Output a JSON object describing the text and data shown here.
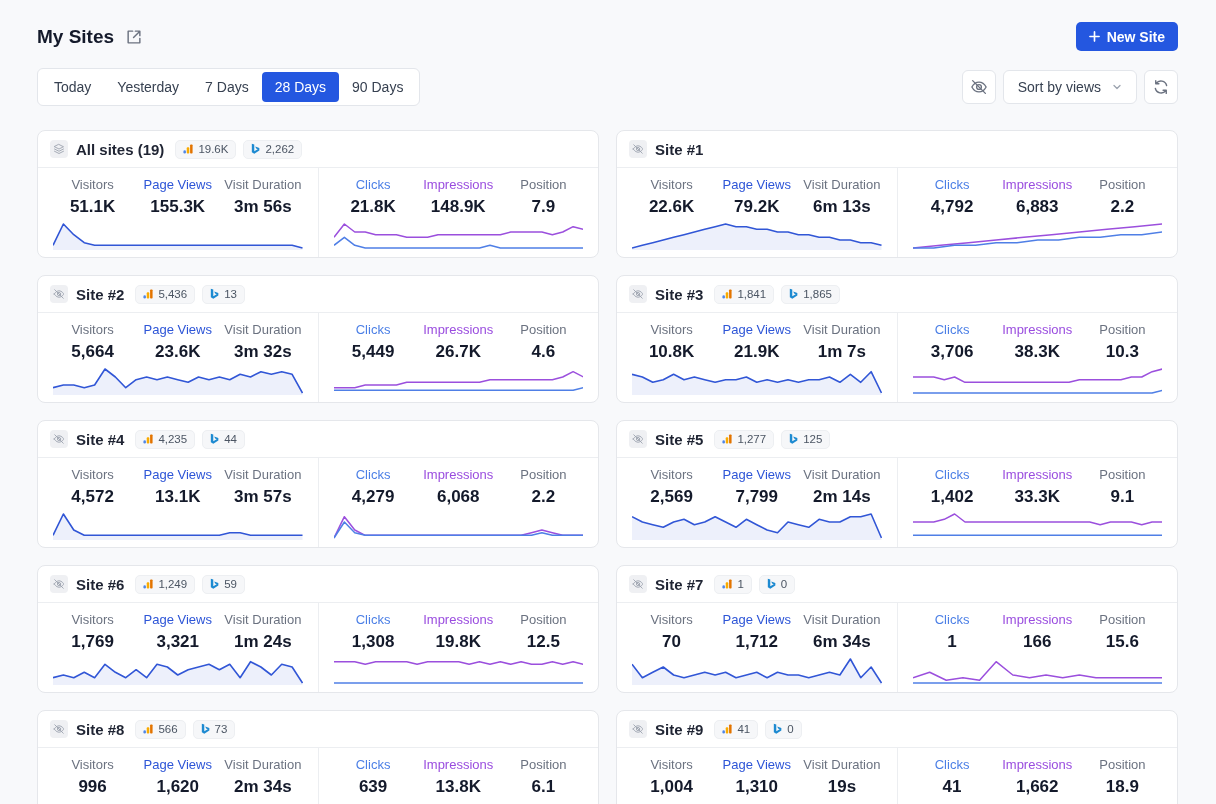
{
  "page": {
    "title": "My Sites"
  },
  "new_site_button": {
    "label": "New Site"
  },
  "ranges": [
    {
      "label": "Today",
      "selected": false
    },
    {
      "label": "Yesterday",
      "selected": false
    },
    {
      "label": "7 Days",
      "selected": false
    },
    {
      "label": "28 Days",
      "selected": true
    },
    {
      "label": "90 Days",
      "selected": false
    }
  ],
  "sort": {
    "label": "Sort by views"
  },
  "cards": [
    {
      "kind": "all",
      "name": "All sites (19)",
      "badges": [
        {
          "kind": "analytics",
          "count": "19.6K"
        },
        {
          "kind": "search",
          "count": "2,262"
        }
      ],
      "analytics": [
        {
          "kind": "visitors",
          "label": "Visitors",
          "value": "51.1K"
        },
        {
          "kind": "pageviews",
          "label": "Page Views",
          "value": "155.3K"
        },
        {
          "kind": "duration",
          "label": "Visit Duration",
          "value": "3m 56s"
        }
      ],
      "search": [
        {
          "kind": "clicks",
          "label": "Clicks",
          "value": "21.8K"
        },
        {
          "kind": "impressions",
          "label": "Impressions",
          "value": "148.9K"
        },
        {
          "kind": "position",
          "label": "Position",
          "value": "7.9"
        }
      ]
    },
    {
      "kind": "site",
      "name": "Site #1",
      "analytics": [
        {
          "kind": "visitors",
          "label": "Visitors",
          "value": "22.6K"
        },
        {
          "kind": "pageviews",
          "label": "Page Views",
          "value": "79.2K"
        },
        {
          "kind": "duration",
          "label": "Visit Duration",
          "value": "6m 13s"
        }
      ],
      "search": [
        {
          "kind": "clicks",
          "label": "Clicks",
          "value": "4,792"
        },
        {
          "kind": "impressions",
          "label": "Impressions",
          "value": "6,883"
        },
        {
          "kind": "position",
          "label": "Position",
          "value": "2.2"
        }
      ]
    },
    {
      "kind": "site",
      "name": "Site #2",
      "badges": [
        {
          "kind": "analytics",
          "count": "5,436"
        },
        {
          "kind": "search",
          "count": "13"
        }
      ],
      "analytics": [
        {
          "kind": "visitors",
          "label": "Visitors",
          "value": "5,664"
        },
        {
          "kind": "pageviews",
          "label": "Page Views",
          "value": "23.6K"
        },
        {
          "kind": "duration",
          "label": "Visit Duration",
          "value": "3m 32s"
        }
      ],
      "search": [
        {
          "kind": "clicks",
          "label": "Clicks",
          "value": "5,449"
        },
        {
          "kind": "impressions",
          "label": "Impressions",
          "value": "26.7K"
        },
        {
          "kind": "position",
          "label": "Position",
          "value": "4.6"
        }
      ]
    },
    {
      "kind": "site",
      "name": "Site #3",
      "badges": [
        {
          "kind": "analytics",
          "count": "1,841"
        },
        {
          "kind": "search",
          "count": "1,865"
        }
      ],
      "analytics": [
        {
          "kind": "visitors",
          "label": "Visitors",
          "value": "10.8K"
        },
        {
          "kind": "pageviews",
          "label": "Page Views",
          "value": "21.9K"
        },
        {
          "kind": "duration",
          "label": "Visit Duration",
          "value": "1m 7s"
        }
      ],
      "search": [
        {
          "kind": "clicks",
          "label": "Clicks",
          "value": "3,706"
        },
        {
          "kind": "impressions",
          "label": "Impressions",
          "value": "38.3K"
        },
        {
          "kind": "position",
          "label": "Position",
          "value": "10.3"
        }
      ]
    },
    {
      "kind": "site",
      "name": "Site #4",
      "badges": [
        {
          "kind": "analytics",
          "count": "4,235"
        },
        {
          "kind": "search",
          "count": "44"
        }
      ],
      "analytics": [
        {
          "kind": "visitors",
          "label": "Visitors",
          "value": "4,572"
        },
        {
          "kind": "pageviews",
          "label": "Page Views",
          "value": "13.1K"
        },
        {
          "kind": "duration",
          "label": "Visit Duration",
          "value": "3m 57s"
        }
      ],
      "search": [
        {
          "kind": "clicks",
          "label": "Clicks",
          "value": "4,279"
        },
        {
          "kind": "impressions",
          "label": "Impressions",
          "value": "6,068"
        },
        {
          "kind": "position",
          "label": "Position",
          "value": "2.2"
        }
      ]
    },
    {
      "kind": "site",
      "name": "Site #5",
      "badges": [
        {
          "kind": "analytics",
          "count": "1,277"
        },
        {
          "kind": "search",
          "count": "125"
        }
      ],
      "analytics": [
        {
          "kind": "visitors",
          "label": "Visitors",
          "value": "2,569"
        },
        {
          "kind": "pageviews",
          "label": "Page Views",
          "value": "7,799"
        },
        {
          "kind": "duration",
          "label": "Visit Duration",
          "value": "2m 14s"
        }
      ],
      "search": [
        {
          "kind": "clicks",
          "label": "Clicks",
          "value": "1,402"
        },
        {
          "kind": "impressions",
          "label": "Impressions",
          "value": "33.3K"
        },
        {
          "kind": "position",
          "label": "Position",
          "value": "9.1"
        }
      ]
    },
    {
      "kind": "site",
      "name": "Site #6",
      "badges": [
        {
          "kind": "analytics",
          "count": "1,249"
        },
        {
          "kind": "search",
          "count": "59"
        }
      ],
      "analytics": [
        {
          "kind": "visitors",
          "label": "Visitors",
          "value": "1,769"
        },
        {
          "kind": "pageviews",
          "label": "Page Views",
          "value": "3,321"
        },
        {
          "kind": "duration",
          "label": "Visit Duration",
          "value": "1m 24s"
        }
      ],
      "search": [
        {
          "kind": "clicks",
          "label": "Clicks",
          "value": "1,308"
        },
        {
          "kind": "impressions",
          "label": "Impressions",
          "value": "19.8K"
        },
        {
          "kind": "position",
          "label": "Position",
          "value": "12.5"
        }
      ]
    },
    {
      "kind": "site",
      "name": "Site #7",
      "badges": [
        {
          "kind": "analytics",
          "count": "1"
        },
        {
          "kind": "search",
          "count": "0"
        }
      ],
      "analytics": [
        {
          "kind": "visitors",
          "label": "Visitors",
          "value": "70"
        },
        {
          "kind": "pageviews",
          "label": "Page Views",
          "value": "1,712"
        },
        {
          "kind": "duration",
          "label": "Visit Duration",
          "value": "6m 34s"
        }
      ],
      "search": [
        {
          "kind": "clicks",
          "label": "Clicks",
          "value": "1"
        },
        {
          "kind": "impressions",
          "label": "Impressions",
          "value": "166"
        },
        {
          "kind": "position",
          "label": "Position",
          "value": "15.6"
        }
      ]
    },
    {
      "kind": "site",
      "name": "Site #8",
      "badges": [
        {
          "kind": "analytics",
          "count": "566"
        },
        {
          "kind": "search",
          "count": "73"
        }
      ],
      "analytics": [
        {
          "kind": "visitors",
          "label": "Visitors",
          "value": "996"
        },
        {
          "kind": "pageviews",
          "label": "Page Views",
          "value": "1,620"
        },
        {
          "kind": "duration",
          "label": "Visit Duration",
          "value": "2m 34s"
        }
      ],
      "search": [
        {
          "kind": "clicks",
          "label": "Clicks",
          "value": "639"
        },
        {
          "kind": "impressions",
          "label": "Impressions",
          "value": "13.8K"
        },
        {
          "kind": "position",
          "label": "Position",
          "value": "6.1"
        }
      ]
    },
    {
      "kind": "site",
      "name": "Site #9",
      "badges": [
        {
          "kind": "analytics",
          "count": "41"
        },
        {
          "kind": "search",
          "count": "0"
        }
      ],
      "analytics": [
        {
          "kind": "visitors",
          "label": "Visitors",
          "value": "1,004"
        },
        {
          "kind": "pageviews",
          "label": "Page Views",
          "value": "1,310"
        },
        {
          "kind": "duration",
          "label": "Visit Duration",
          "value": "19s"
        }
      ],
      "search": [
        {
          "kind": "clicks",
          "label": "Clicks",
          "value": "41"
        },
        {
          "kind": "impressions",
          "label": "Impressions",
          "value": "1,662"
        },
        {
          "kind": "position",
          "label": "Position",
          "value": "18.9"
        }
      ]
    }
  ]
}
